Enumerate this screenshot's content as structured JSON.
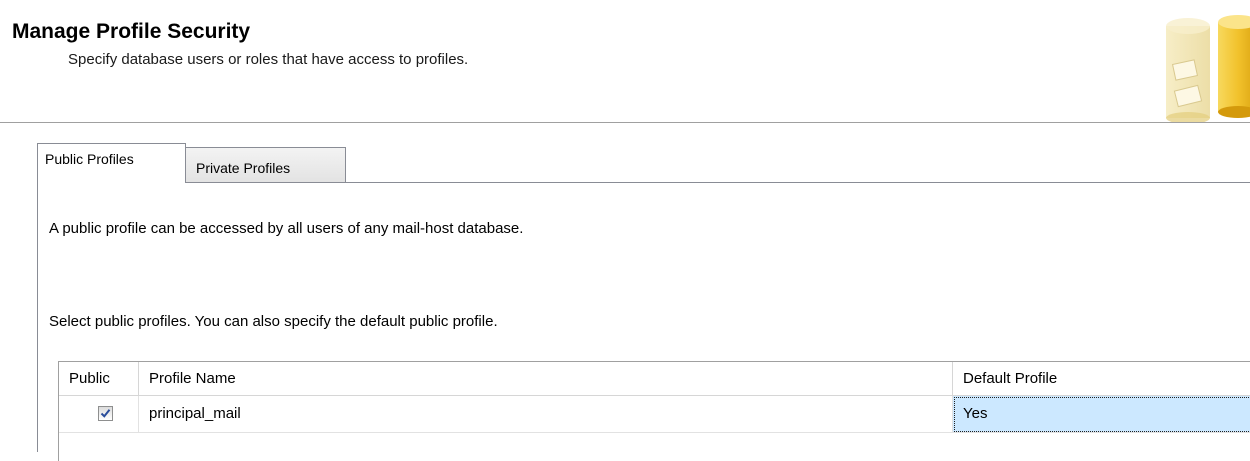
{
  "header": {
    "title": "Manage Profile Security",
    "subtitle": "Specify database users or roles that have access to profiles.",
    "graphic_icon": "database-security-icon"
  },
  "tabs": [
    {
      "label": "Public Profiles",
      "selected": true
    },
    {
      "label": "Private Profiles",
      "selected": false
    }
  ],
  "panel": {
    "description": "A public profile can be accessed by all users of any mail-host database.",
    "instruction": "Select public profiles. You can also specify the default public profile."
  },
  "grid": {
    "columns": [
      "Public",
      "Profile Name",
      "Default Profile"
    ],
    "rows": [
      {
        "public": true,
        "profile_name": "principal_mail",
        "default_profile": "Yes"
      }
    ]
  },
  "colors": {
    "selection": "#cce8ff",
    "border": "#898c95"
  }
}
